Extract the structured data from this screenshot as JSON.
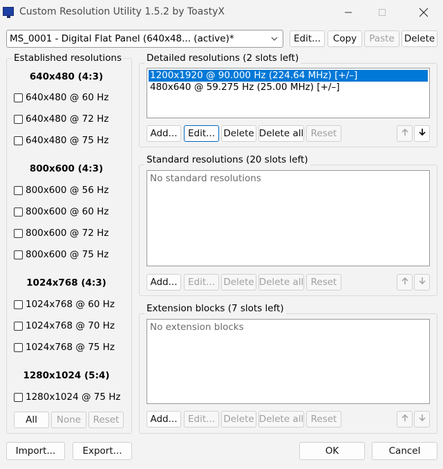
{
  "window": {
    "title": "Custom Resolution Utility 1.5.2 by ToastyX",
    "minimize_icon": "minimize-icon",
    "maximize_icon": "maximize-icon",
    "close_icon": "close-icon"
  },
  "top": {
    "monitor_select": "MS_0001 - Digital Flat Panel (640x48... (active)*",
    "edit": "Edit...",
    "copy": "Copy",
    "paste": "Paste",
    "delete": "Delete"
  },
  "established": {
    "title": "Established resolutions",
    "groups": [
      {
        "header": "640x480 (4:3)",
        "items": [
          "640x480 @ 60 Hz",
          "640x480 @ 72 Hz",
          "640x480 @ 75 Hz"
        ]
      },
      {
        "header": "800x600 (4:3)",
        "items": [
          "800x600 @ 56 Hz",
          "800x600 @ 60 Hz",
          "800x600 @ 72 Hz",
          "800x600 @ 75 Hz"
        ]
      },
      {
        "header": "1024x768 (4:3)",
        "items": [
          "1024x768 @ 60 Hz",
          "1024x768 @ 70 Hz",
          "1024x768 @ 75 Hz"
        ]
      },
      {
        "header": "1280x1024 (5:4)",
        "items": [
          "1280x1024 @ 75 Hz"
        ]
      }
    ],
    "all": "All",
    "none": "None",
    "reset": "Reset"
  },
  "detailed": {
    "title": "Detailed resolutions (2 slots left)",
    "rows": [
      "1200x1920 @ 90.000 Hz (224.64 MHz) [+/–]",
      "480x640 @ 59.275 Hz (25.00 MHz) [+/–]"
    ],
    "add": "Add...",
    "edit": "Edit...",
    "delete": "Delete",
    "delete_all": "Delete all",
    "reset": "Reset"
  },
  "standard": {
    "title": "Standard resolutions (20 slots left)",
    "empty": "No standard resolutions",
    "add": "Add...",
    "edit": "Edit...",
    "delete": "Delete",
    "delete_all": "Delete all",
    "reset": "Reset"
  },
  "extension": {
    "title": "Extension blocks (7 slots left)",
    "empty": "No extension blocks",
    "add": "Add...",
    "edit": "Edit...",
    "delete": "Delete",
    "delete_all": "Delete all",
    "reset": "Reset"
  },
  "bottom": {
    "import": "Import...",
    "export": "Export...",
    "ok": "OK",
    "cancel": "Cancel"
  },
  "colors": {
    "selection": "#0078d7",
    "focus_border": "#0067c0",
    "disabled_text": "#a0a0a0"
  }
}
